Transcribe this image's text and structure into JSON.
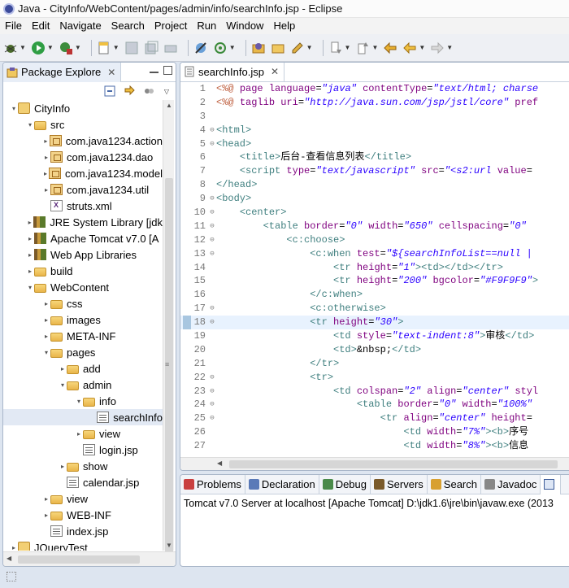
{
  "window": {
    "title": "Java - CityInfo/WebContent/pages/admin/info/searchInfo.jsp - Eclipse"
  },
  "menu": [
    "File",
    "Edit",
    "Navigate",
    "Search",
    "Project",
    "Run",
    "Window",
    "Help"
  ],
  "left_panel": {
    "tab_label": "Package Explore",
    "tree": [
      {
        "label": "CityInfo",
        "icon": "project-icon",
        "level": 0,
        "arrow": "▾"
      },
      {
        "label": "src",
        "icon": "source-folder-icon",
        "level": 1,
        "arrow": "▾"
      },
      {
        "label": "com.java1234.action",
        "icon": "package-icon",
        "level": 2,
        "arrow": "▸"
      },
      {
        "label": "com.java1234.dao",
        "icon": "package-icon",
        "level": 2,
        "arrow": "▸"
      },
      {
        "label": "com.java1234.model",
        "icon": "package-icon",
        "level": 2,
        "arrow": "▸"
      },
      {
        "label": "com.java1234.util",
        "icon": "package-icon",
        "level": 2,
        "arrow": "▸"
      },
      {
        "label": "struts.xml",
        "icon": "xml-file-icon",
        "level": 2,
        "arrow": ""
      },
      {
        "label": "JRE System Library [jdk",
        "icon": "library-icon",
        "level": 1,
        "arrow": "▸"
      },
      {
        "label": "Apache Tomcat v7.0 [A",
        "icon": "library-icon",
        "level": 1,
        "arrow": "▸"
      },
      {
        "label": "Web App Libraries",
        "icon": "library-icon",
        "level": 1,
        "arrow": "▸"
      },
      {
        "label": "build",
        "icon": "folder-icon",
        "level": 1,
        "arrow": "▸"
      },
      {
        "label": "WebContent",
        "icon": "folder-icon",
        "level": 1,
        "arrow": "▾"
      },
      {
        "label": "css",
        "icon": "folder-icon",
        "level": 2,
        "arrow": "▸"
      },
      {
        "label": "images",
        "icon": "folder-icon",
        "level": 2,
        "arrow": "▸"
      },
      {
        "label": "META-INF",
        "icon": "folder-icon",
        "level": 2,
        "arrow": "▸"
      },
      {
        "label": "pages",
        "icon": "folder-icon",
        "level": 2,
        "arrow": "▾"
      },
      {
        "label": "add",
        "icon": "folder-icon",
        "level": 3,
        "arrow": "▸"
      },
      {
        "label": "admin",
        "icon": "folder-icon",
        "level": 3,
        "arrow": "▾"
      },
      {
        "label": "info",
        "icon": "folder-icon",
        "level": 4,
        "arrow": "▾"
      },
      {
        "label": "searchInfo",
        "icon": "jsp-file-icon",
        "level": 5,
        "arrow": "",
        "selected": true
      },
      {
        "label": "view",
        "icon": "folder-icon",
        "level": 4,
        "arrow": "▸"
      },
      {
        "label": "login.jsp",
        "icon": "jsp-file-icon",
        "level": 4,
        "arrow": ""
      },
      {
        "label": "show",
        "icon": "folder-icon",
        "level": 3,
        "arrow": "▸"
      },
      {
        "label": "calendar.jsp",
        "icon": "jsp-file-icon",
        "level": 3,
        "arrow": ""
      },
      {
        "label": "view",
        "icon": "folder-icon",
        "level": 2,
        "arrow": "▸"
      },
      {
        "label": "WEB-INF",
        "icon": "folder-icon",
        "level": 2,
        "arrow": "▸"
      },
      {
        "label": "index.jsp",
        "icon": "jsp-file-icon",
        "level": 2,
        "arrow": ""
      },
      {
        "label": "JQueryTest",
        "icon": "project-icon",
        "level": 0,
        "arrow": "▸"
      }
    ]
  },
  "editor": {
    "tab_label": "searchInfo.jsp",
    "highlighted_line": 18,
    "lines": [
      {
        "n": "1",
        "fold": "",
        "segs": [
          [
            "k",
            "<%@ "
          ],
          [
            "a",
            "page "
          ],
          [
            "a",
            "language"
          ],
          [
            "p",
            "="
          ],
          [
            "v",
            "\"java\""
          ],
          [
            "p",
            " "
          ],
          [
            "a",
            "contentType"
          ],
          [
            "p",
            "="
          ],
          [
            "v",
            "\"text/html; charse"
          ]
        ]
      },
      {
        "n": "2",
        "fold": "",
        "segs": [
          [
            "k",
            "<%@ "
          ],
          [
            "a",
            "taglib "
          ],
          [
            "a",
            "uri"
          ],
          [
            "p",
            "="
          ],
          [
            "v",
            "\"http://java.sun.com/jsp/jstl/core\""
          ],
          [
            "p",
            " "
          ],
          [
            "a",
            "pref"
          ]
        ]
      },
      {
        "n": "3",
        "fold": "",
        "segs": []
      },
      {
        "n": "4",
        "fold": "⊖",
        "segs": [
          [
            "t",
            "<html>"
          ]
        ]
      },
      {
        "n": "5",
        "fold": "⊖",
        "segs": [
          [
            "t",
            "<head>"
          ]
        ]
      },
      {
        "n": "6",
        "fold": "",
        "segs": [
          [
            "p",
            "    "
          ],
          [
            "t",
            "<title>"
          ],
          [
            "p",
            "后台-查看信息列表"
          ],
          [
            "t",
            "</title>"
          ]
        ]
      },
      {
        "n": "7",
        "fold": "",
        "segs": [
          [
            "p",
            "    "
          ],
          [
            "t",
            "<script "
          ],
          [
            "a",
            "type"
          ],
          [
            "p",
            "="
          ],
          [
            "v",
            "\"text/javascript\""
          ],
          [
            "p",
            " "
          ],
          [
            "a",
            "src"
          ],
          [
            "p",
            "="
          ],
          [
            "v",
            "\"<s2:url "
          ],
          [
            "a",
            "value"
          ],
          [
            "p",
            "="
          ]
        ]
      },
      {
        "n": "8",
        "fold": "",
        "segs": [
          [
            "t",
            "</head>"
          ]
        ]
      },
      {
        "n": "9",
        "fold": "⊖",
        "segs": [
          [
            "t",
            "<body>"
          ]
        ]
      },
      {
        "n": "10",
        "fold": "⊖",
        "segs": [
          [
            "p",
            "    "
          ],
          [
            "t",
            "<center>"
          ]
        ]
      },
      {
        "n": "11",
        "fold": "⊖",
        "segs": [
          [
            "p",
            "        "
          ],
          [
            "t",
            "<table "
          ],
          [
            "a",
            "border"
          ],
          [
            "p",
            "="
          ],
          [
            "v",
            "\"0\""
          ],
          [
            "p",
            " "
          ],
          [
            "a",
            "width"
          ],
          [
            "p",
            "="
          ],
          [
            "v",
            "\"650\""
          ],
          [
            "p",
            " "
          ],
          [
            "a",
            "cellspacing"
          ],
          [
            "p",
            "="
          ],
          [
            "v",
            "\"0\""
          ]
        ]
      },
      {
        "n": "12",
        "fold": "⊖",
        "segs": [
          [
            "p",
            "            "
          ],
          [
            "t",
            "<c:choose>"
          ]
        ]
      },
      {
        "n": "13",
        "fold": "⊖",
        "segs": [
          [
            "p",
            "                "
          ],
          [
            "t",
            "<c:when "
          ],
          [
            "a",
            "test"
          ],
          [
            "p",
            "="
          ],
          [
            "v",
            "\"${searchInfoList==null |"
          ]
        ]
      },
      {
        "n": "14",
        "fold": "",
        "segs": [
          [
            "p",
            "                    "
          ],
          [
            "t",
            "<tr "
          ],
          [
            "a",
            "height"
          ],
          [
            "p",
            "="
          ],
          [
            "v",
            "\"1\""
          ],
          [
            "t",
            ">"
          ],
          [
            "t",
            "<td>"
          ],
          [
            "t",
            "</td>"
          ],
          [
            "t",
            "</tr>"
          ]
        ]
      },
      {
        "n": "15",
        "fold": "",
        "segs": [
          [
            "p",
            "                    "
          ],
          [
            "t",
            "<tr "
          ],
          [
            "a",
            "height"
          ],
          [
            "p",
            "="
          ],
          [
            "v",
            "\"200\""
          ],
          [
            "p",
            " "
          ],
          [
            "a",
            "bgcolor"
          ],
          [
            "p",
            "="
          ],
          [
            "v",
            "\"#F9F9F9\""
          ],
          [
            "t",
            ">"
          ]
        ]
      },
      {
        "n": "16",
        "fold": "",
        "segs": [
          [
            "p",
            "                "
          ],
          [
            "t",
            "</c:when>"
          ]
        ]
      },
      {
        "n": "17",
        "fold": "⊖",
        "segs": [
          [
            "p",
            "                "
          ],
          [
            "t",
            "<c:otherwise>"
          ]
        ]
      },
      {
        "n": "18",
        "fold": "⊖",
        "segs": [
          [
            "p",
            "                "
          ],
          [
            "t",
            "<tr "
          ],
          [
            "a",
            "height"
          ],
          [
            "p",
            "="
          ],
          [
            "v",
            "\"30\""
          ],
          [
            "t",
            ">"
          ]
        ]
      },
      {
        "n": "19",
        "fold": "",
        "segs": [
          [
            "p",
            "                    "
          ],
          [
            "t",
            "<td "
          ],
          [
            "a",
            "style"
          ],
          [
            "p",
            "="
          ],
          [
            "v",
            "\"text-indent:8\""
          ],
          [
            "t",
            ">"
          ],
          [
            "p",
            "审核"
          ],
          [
            "t",
            "</td>"
          ]
        ]
      },
      {
        "n": "20",
        "fold": "",
        "segs": [
          [
            "p",
            "                    "
          ],
          [
            "t",
            "<td>"
          ],
          [
            "p",
            "&nbsp;"
          ],
          [
            "t",
            "</td>"
          ]
        ]
      },
      {
        "n": "21",
        "fold": "",
        "segs": [
          [
            "p",
            "                "
          ],
          [
            "t",
            "</tr>"
          ]
        ]
      },
      {
        "n": "22",
        "fold": "⊖",
        "segs": [
          [
            "p",
            "                "
          ],
          [
            "t",
            "<tr>"
          ]
        ]
      },
      {
        "n": "23",
        "fold": "⊖",
        "segs": [
          [
            "p",
            "                    "
          ],
          [
            "t",
            "<td "
          ],
          [
            "a",
            "colspan"
          ],
          [
            "p",
            "="
          ],
          [
            "v",
            "\"2\""
          ],
          [
            "p",
            " "
          ],
          [
            "a",
            "align"
          ],
          [
            "p",
            "="
          ],
          [
            "v",
            "\"center\""
          ],
          [
            "p",
            " "
          ],
          [
            "a",
            "styl"
          ]
        ]
      },
      {
        "n": "24",
        "fold": "⊖",
        "segs": [
          [
            "p",
            "                        "
          ],
          [
            "t",
            "<table "
          ],
          [
            "a",
            "border"
          ],
          [
            "p",
            "="
          ],
          [
            "v",
            "\"0\""
          ],
          [
            "p",
            " "
          ],
          [
            "a",
            "width"
          ],
          [
            "p",
            "="
          ],
          [
            "v",
            "\"100%\""
          ]
        ]
      },
      {
        "n": "25",
        "fold": "⊖",
        "segs": [
          [
            "p",
            "                            "
          ],
          [
            "t",
            "<tr "
          ],
          [
            "a",
            "align"
          ],
          [
            "p",
            "="
          ],
          [
            "v",
            "\"center\""
          ],
          [
            "p",
            " "
          ],
          [
            "a",
            "height"
          ],
          [
            "p",
            "="
          ]
        ]
      },
      {
        "n": "26",
        "fold": "",
        "segs": [
          [
            "p",
            "                                "
          ],
          [
            "t",
            "<td "
          ],
          [
            "a",
            "width"
          ],
          [
            "p",
            "="
          ],
          [
            "v",
            "\"7%\""
          ],
          [
            "t",
            ">"
          ],
          [
            "t",
            "<b>"
          ],
          [
            "p",
            "序号"
          ]
        ]
      },
      {
        "n": "27",
        "fold": "",
        "segs": [
          [
            "p",
            "                                "
          ],
          [
            "t",
            "<td "
          ],
          [
            "a",
            "width"
          ],
          [
            "p",
            "="
          ],
          [
            "v",
            "\"8%\""
          ],
          [
            "t",
            ">"
          ],
          [
            "t",
            "<b>"
          ],
          [
            "p",
            "信息"
          ]
        ]
      }
    ]
  },
  "console": {
    "tabs": [
      {
        "label": "Problems",
        "icon": "problems-icon"
      },
      {
        "label": "Declaration",
        "icon": "declaration-icon"
      },
      {
        "label": "Debug",
        "icon": "debug-icon"
      },
      {
        "label": "Servers",
        "icon": "servers-icon"
      },
      {
        "label": "Search",
        "icon": "search-icon"
      },
      {
        "label": "Javadoc",
        "icon": "javadoc-icon"
      }
    ],
    "text": "Tomcat v7.0 Server at localhost [Apache Tomcat] D:\\jdk1.6\\jre\\bin\\javaw.exe (2013"
  }
}
